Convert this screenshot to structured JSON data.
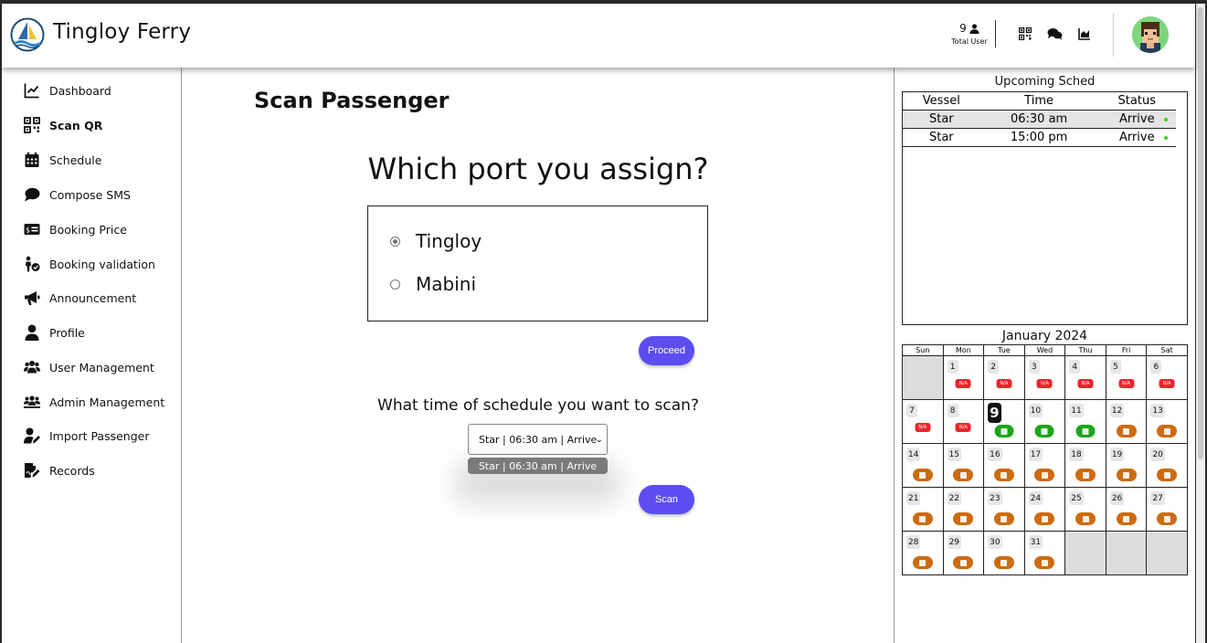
{
  "header": {
    "app_title": "Tingloy Ferry",
    "total_user_count": "9",
    "total_user_label": "Total User",
    "icons": [
      "user-icon",
      "qr-icon",
      "chat-icon",
      "chart-icon"
    ]
  },
  "sidebar": {
    "items": [
      {
        "label": "Dashboard",
        "icon": "chart-line-icon"
      },
      {
        "label": "Scan QR",
        "icon": "qr-icon",
        "active": true
      },
      {
        "label": "Schedule",
        "icon": "calendar-icon"
      },
      {
        "label": "Compose SMS",
        "icon": "chat-bubble-icon"
      },
      {
        "label": "Booking Price",
        "icon": "money-icon"
      },
      {
        "label": "Booking validation",
        "icon": "user-check-icon"
      },
      {
        "label": "Announcement",
        "icon": "megaphone-icon"
      },
      {
        "label": "Profile",
        "icon": "user-icon"
      },
      {
        "label": "User Management",
        "icon": "users-icon"
      },
      {
        "label": "Admin Management",
        "icon": "users-group-icon"
      },
      {
        "label": "Import Passenger",
        "icon": "user-edit-icon"
      },
      {
        "label": "Records",
        "icon": "file-signature-icon"
      }
    ]
  },
  "main": {
    "page_title": "Scan Passenger",
    "port_question": "Which port you assign?",
    "ports": [
      {
        "label": "Tingloy",
        "checked": true
      },
      {
        "label": "Mabini",
        "checked": false
      }
    ],
    "proceed_label": "Proceed",
    "schedule_question": "What time of schedule you want to scan?",
    "schedule_select_value": "Star | 06:30 am | Arrive",
    "schedule_option": "Star | 06:30 am | Arrive",
    "scan_label": "Scan"
  },
  "upcoming": {
    "title": "Upcoming Sched",
    "columns": [
      "Vessel",
      "Time",
      "Status"
    ],
    "rows": [
      {
        "vessel": "Star",
        "time": "06:30 am",
        "status": "Arrive"
      },
      {
        "vessel": "Star",
        "time": "15:00 pm",
        "status": "Arrive"
      }
    ],
    "status_dot_color": "#3ad617"
  },
  "calendar": {
    "title": "January 2024",
    "weekdays": [
      "Sun",
      "Mon",
      "Tue",
      "Wed",
      "Thu",
      "Fri",
      "Sat"
    ],
    "today": 9,
    "na_label": "N/A",
    "weeks": [
      [
        null,
        {
          "d": "1",
          "s": "na"
        },
        {
          "d": "2",
          "s": "na"
        },
        {
          "d": "3",
          "s": "na"
        },
        {
          "d": "4",
          "s": "na"
        },
        {
          "d": "5",
          "s": "na"
        },
        {
          "d": "6",
          "s": "na"
        }
      ],
      [
        {
          "d": "7",
          "s": "na"
        },
        {
          "d": "8",
          "s": "na"
        },
        {
          "d": "9",
          "s": "open"
        },
        {
          "d": "10",
          "s": "open"
        },
        {
          "d": "11",
          "s": "open"
        },
        {
          "d": "12",
          "s": "book"
        },
        {
          "d": "13",
          "s": "book"
        }
      ],
      [
        {
          "d": "14",
          "s": "book"
        },
        {
          "d": "15",
          "s": "book"
        },
        {
          "d": "16",
          "s": "book"
        },
        {
          "d": "17",
          "s": "book"
        },
        {
          "d": "18",
          "s": "book"
        },
        {
          "d": "19",
          "s": "book"
        },
        {
          "d": "20",
          "s": "book"
        }
      ],
      [
        {
          "d": "21",
          "s": "book"
        },
        {
          "d": "22",
          "s": "book"
        },
        {
          "d": "23",
          "s": "book"
        },
        {
          "d": "24",
          "s": "book"
        },
        {
          "d": "25",
          "s": "book"
        },
        {
          "d": "26",
          "s": "book"
        },
        {
          "d": "27",
          "s": "book"
        }
      ],
      [
        {
          "d": "28",
          "s": "book"
        },
        {
          "d": "29",
          "s": "book"
        },
        {
          "d": "30",
          "s": "book"
        },
        {
          "d": "31",
          "s": "book"
        },
        null,
        null,
        null
      ]
    ],
    "colors": {
      "na": "#e8262b",
      "open": "#1ea51a",
      "book": "#cd6b10"
    }
  }
}
